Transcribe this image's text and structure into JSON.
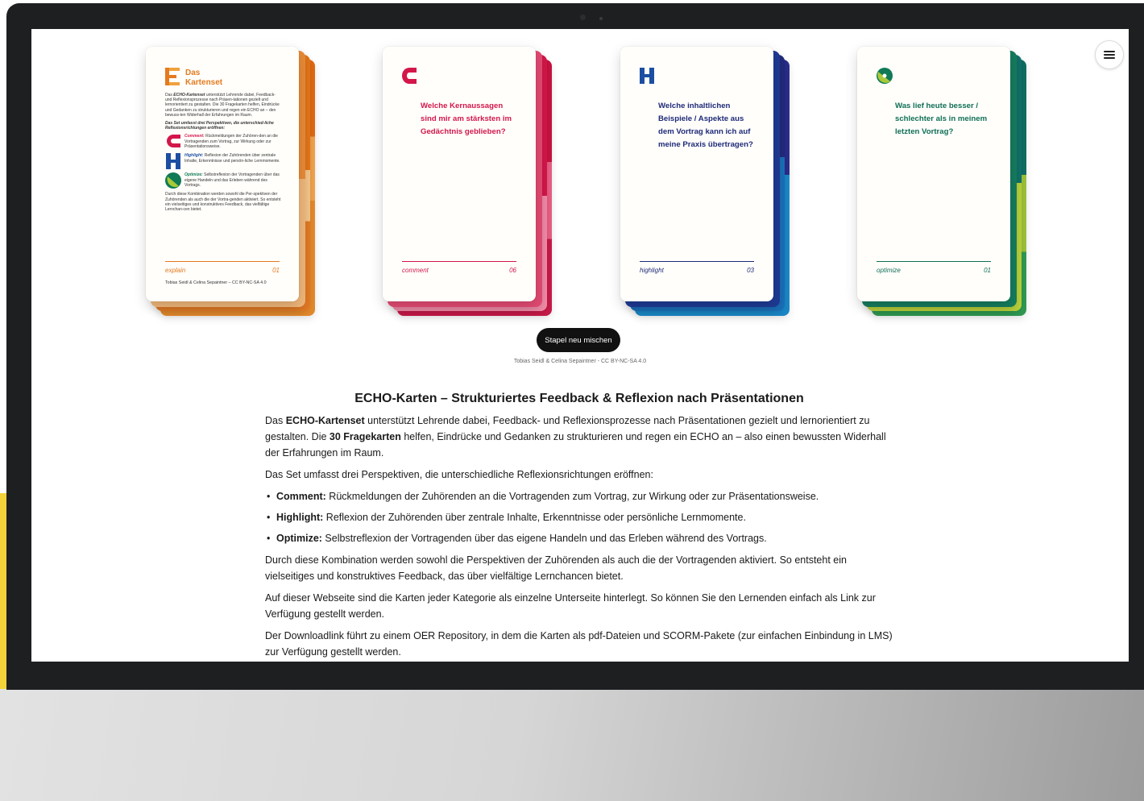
{
  "header": {
    "menu_icon": "hamburger-menu-icon"
  },
  "intro_card": {
    "title_line1": "Das",
    "title_line2": "Kartenset",
    "p1_prefix": "Das",
    "p1_brand": "ECHO-Kartenset",
    "p1_text": "unterstützt Lehrende dabei, Feedback- und Reflexionsprozesse nach Präsen-tationen gezielt und lernorientiert zu gestalten. Die 30 Fragekarten helfen, Eindrücke und Gedanken zu strukturieren und regen ein ECHO an – den bewuss-ten Widerhall der Erfahrungen im Raum.",
    "p2": "Das Set umfasst drei Perspektiven, die unterschied-liche Reflexionsrichtungen eröffnen:",
    "items": [
      {
        "label": "Comment:",
        "text": "Rückmeldungen der Zuhören-den an die Vortragenden zum Vortrag, zur Wirkung oder zur Präsentationsweise.",
        "color": "#d3174a",
        "icon": "c-letter-icon"
      },
      {
        "label": "Highlight:",
        "text": "Reflexion der Zuhörenden über zentrale Inhalte, Erkenntnisse und persön-liche Lernmomente.",
        "color": "#1c4fa1",
        "icon": "h-letter-icon"
      },
      {
        "label": "Optimize:",
        "text": "Selbstreflexion der Vortragenden über das eigene Handeln und das Erleben während des Vortrags.",
        "color": "#0f7a55",
        "icon": "o-circle-icon"
      }
    ],
    "p3": "Durch diese Kombination werden sowohl die Per-spektiven der Zuhörenden als auch die der Vortra-genden aktiviert. So entsteht ein vielseitiges und konstruktives Feedback, das vielfältige Lernchan-cen bietet.",
    "category": "explain",
    "number": "01",
    "credit": "Tobias Seidl & Celina Sepaintner – CC BY-NC-SA 4.0",
    "color": "#e57a1f"
  },
  "cards": [
    {
      "question": "Welche Kernaussagen sind mir am stärksten im Gedächtnis geblieben?",
      "category": "comment",
      "number": "06",
      "color": "#d3174a",
      "icon": "c-letter-icon"
    },
    {
      "question": "Welche inhaltlichen Beispiele / Aspekte aus dem Vortrag kann ich auf meine Praxis übertragen?",
      "category": "highlight",
      "number": "03",
      "color": "#1e2a78",
      "icon": "h-letter-icon"
    },
    {
      "question": "Was lief heute besser / schlechter als in meinem letzten Vortrag?",
      "category": "optimize",
      "number": "01",
      "color": "#0f6e55",
      "icon": "o-circle-icon"
    }
  ],
  "shuffle_button": "Stapel neu mischen",
  "license_line": "Tobias Seidl & Celina Sepaintner - CC BY-NC-SA 4.0",
  "article": {
    "heading": "ECHO-Karten – Strukturiertes Feedback & Reflexion nach Präsentationen",
    "p1": {
      "a": "Das ",
      "b1": "ECHO-Kartenset",
      "c": " unterstützt Lehrende dabei, Feedback- und Reflexionsprozesse nach Präsentationen gezielt und lernorientiert zu gestalten. Die ",
      "b2": "30 Fragekarten",
      "d": " helfen, Eindrücke und Gedanken zu strukturieren und regen ein ECHO an – also einen bewussten Widerhall der Erfahrungen im Raum."
    },
    "p2": "Das Set umfasst drei Perspektiven, die unterschiedliche Reflexionsrichtungen eröffnen:",
    "bullets": [
      {
        "label": "Comment:",
        "text": " Rückmeldungen der Zuhörenden an die Vortragenden zum Vortrag, zur Wirkung oder zur Präsentationsweise."
      },
      {
        "label": "Highlight:",
        "text": " Reflexion der Zuhörenden über zentrale Inhalte, Erkenntnisse oder persönliche Lernmomente."
      },
      {
        "label": "Optimize:",
        "text": " Selbstreflexion der Vortragenden über das eigene Handeln und das Erleben während des Vortrags."
      }
    ],
    "p3": "Durch diese Kombination werden sowohl die Perspektiven der Zuhörenden als auch die der Vortragenden aktiviert. So entsteht ein vielseitiges und konstruktives Feedback, das über vielfältige Lernchancen bietet.",
    "p4": "Auf dieser Webseite sind die Karten jeder Kategorie als einzelne Unterseite hinterlegt. So können Sie den Lernenden einfach als Link zur Verfügung gestellt werden.",
    "p5": "Der Downloadlink führt zu einem OER Repository, in dem die Karten als pdf-Dateien und SCORM-Pakete (zur einfachen Einbindung in LMS) zur Verfügung gestellt werden."
  }
}
